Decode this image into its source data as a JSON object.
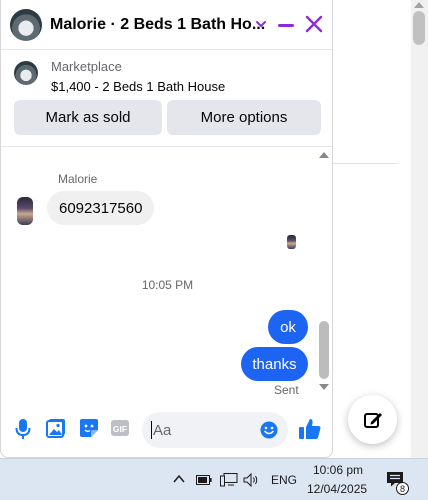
{
  "chat": {
    "title": "Malorie · 2 Beds 1 Bath Ho...",
    "listing": {
      "label": "Marketplace",
      "title": "$1,400 - 2 Beds 1 Bath House"
    },
    "actions": {
      "mark_sold": "Mark as sold",
      "more_options": "More options"
    },
    "messages": {
      "sender_name": "Malorie",
      "incoming_text": "6092317560",
      "timestamp": "10:05 PM",
      "outgoing": [
        "ok",
        "thanks"
      ],
      "status": "Sent"
    },
    "composer": {
      "placeholder": "Aa"
    }
  },
  "taskbar": {
    "language": "ENG",
    "time": "10:06 pm",
    "date": "12/04/2025",
    "notification_count": "8"
  },
  "colors": {
    "accent_purple": "#8a2be2",
    "bubble_blue": "#1d64f2",
    "icon_blue": "#1877f2",
    "taskbar_bg": "#dce6f2"
  },
  "icons": [
    "chevron-down-icon",
    "minimize-icon",
    "close-icon",
    "microphone-icon",
    "photo-icon",
    "sticker-icon",
    "gif-icon",
    "emoji-icon",
    "like-icon",
    "compose-icon",
    "chevron-up-icon",
    "battery-icon",
    "network-icon",
    "volume-icon",
    "notification-icon"
  ]
}
